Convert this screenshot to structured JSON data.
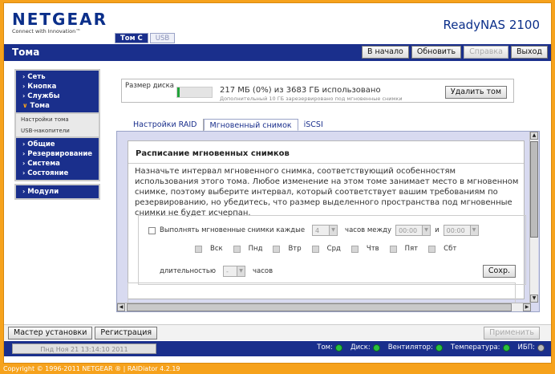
{
  "brand": {
    "logo": "NETGEAR",
    "tagline": "Connect with Innovation™",
    "product": "ReadyNAS 2100"
  },
  "top_tabs": [
    {
      "label": "Том C",
      "active": true
    },
    {
      "label": "USB",
      "active": false
    }
  ],
  "page_title": "Тома",
  "top_buttons": {
    "home": "В начало",
    "refresh": "Обновить",
    "help": "Справка",
    "logout": "Выход"
  },
  "nav": {
    "items_a": [
      "Сеть",
      "Кнопка",
      "Службы"
    ],
    "open_item": "Тома",
    "sub_items": [
      "Настройки тома",
      "USB-накопители"
    ],
    "items_b": [
      "Общие",
      "Резервирование",
      "Система",
      "Состояние"
    ],
    "modules": "Модули"
  },
  "disk": {
    "label": "Размер диска",
    "used_text": "217 МБ (0%) из 3683 ГБ использовано",
    "reserved_text": "Дополнительный 10 ГБ зарезервировано под мгновенные снимки",
    "fill_fraction": 0.06,
    "delete_button": "Удалить том"
  },
  "content_tabs": [
    "Настройки RAID",
    "Мгновенный снимок",
    "iSCSI"
  ],
  "schedule": {
    "title": "Расписание мгновенных снимков",
    "description": "Назначьте интервал мгновенного снимка, соответствующий особенностям использования этого тома. Любое изменение на этом томе занимает место в мгновенном снимке, поэтому выберите интервал, который соответствует вашим требованиям по резервированию, но убедитесь, что размер выделенного пространства под мгновенные снимки не будет исчерпан.",
    "every_label": "Выполнять мгновенные снимки каждые",
    "every_value": "4",
    "hours_between": "часов между",
    "from_time": "00:00",
    "and_label": "и",
    "to_time": "00:00",
    "days": [
      "Вск",
      "Пнд",
      "Втр",
      "Срд",
      "Чтв",
      "Пят",
      "Сбт"
    ],
    "duration_label": "длительностью",
    "duration_value": "-",
    "hours_label": "часов",
    "save_button": "Сохр."
  },
  "footer": {
    "wizard": "Мастер установки",
    "register": "Регистрация",
    "apply": "Применить"
  },
  "status": {
    "datetime": "Пнд Ноя 21  13:14:10 2011",
    "indicators": [
      {
        "label": "Том:",
        "state": "ok"
      },
      {
        "label": "Диск:",
        "state": "ok"
      },
      {
        "label": "Вентилятор:",
        "state": "ok"
      },
      {
        "label": "Температура:",
        "state": "ok"
      },
      {
        "label": "ИБП:",
        "state": "off"
      }
    ]
  },
  "copyright": "Copyright © 1996-2011 NETGEAR ® | RAIDiator 4.2.19",
  "colors": {
    "brand_blue": "#1a2f8c",
    "accent_orange": "#f6a21c",
    "led_green": "#29c13e"
  }
}
